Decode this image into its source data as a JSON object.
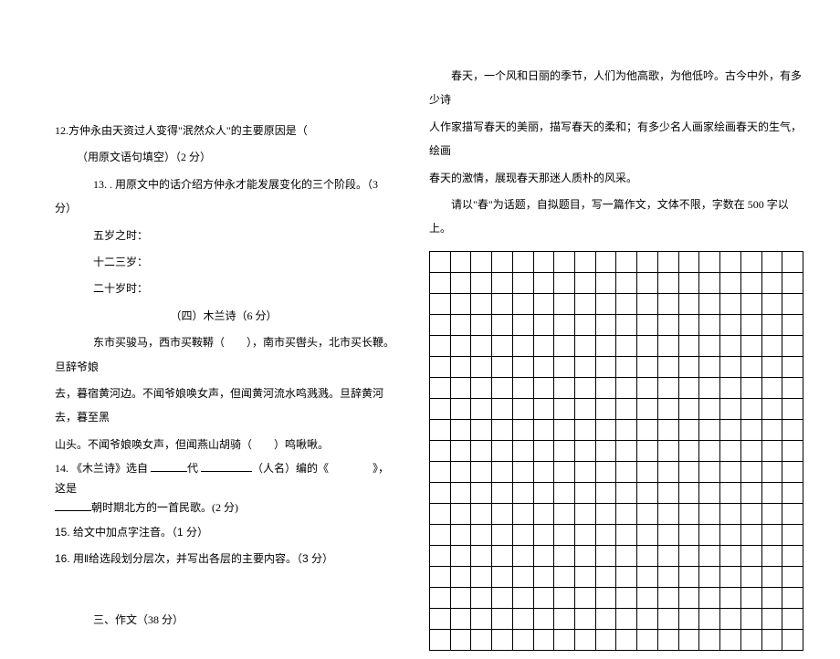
{
  "left": {
    "q12": "12.方仲永由天资过人变得\"泯然众人\"的主要原因是（",
    "q12b": "（用原文语句填空）（2 分）",
    "q13": "13. . 用原文中的话介绍方仲永才能发展变化的三个阶段。（3 分）",
    "age5": "五岁之时：",
    "age12": "十二三岁：",
    "age20": "二十岁时：",
    "subhead4": "（四）木兰诗（6 分）",
    "poem1": "东市买骏马，西市买鞍鞯（　　），南市买辔头，北市买长鞭。　旦辞爷娘",
    "poem2": "去，暮宿黄河边。不闻爷娘唤女声，但闻黄河流水鸣溅溅。旦辞黄河去，暮至黑",
    "poem3": "山头。不闻爷娘唤女声，但闻燕山胡骑（　　）鸣啾啾。",
    "q14a": "14. 《木兰诗》选自 ",
    "q14b": "代 ",
    "q14c": "（人名）编的《　　　　》，这是",
    "q14d": "朝时期北方的一首民歌。(2 分)",
    "q15": "15. 给文中加点字注音。（1 分）",
    "q16": "16. 用‖给选段划分层次，并写出各层的主要内容。（3 分）",
    "sec3": "三、作文（38 分）"
  },
  "right": {
    "p1": "春天，一个风和日丽的季节，人们为他高歌，为他低吟。古今中外，有多少诗",
    "p2": "人作家描写春天的美丽，描写春天的柔和；有多少名人画家绘画春天的生气，绘画",
    "p3": "春天的激情，展现春天那迷人质朴的风采。",
    "p4": "请以\"春\"为话题，自拟题目，写一篇作文，文体不限，字数在 500 字以上。"
  },
  "grid": {
    "rows": 19,
    "cols": 18
  }
}
